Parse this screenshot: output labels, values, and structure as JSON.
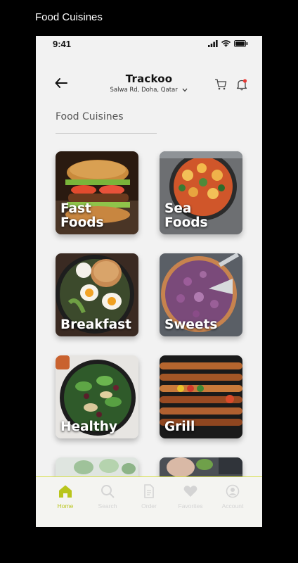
{
  "frame_title": "Food Cuisines",
  "status_bar": {
    "time": "9:41"
  },
  "header": {
    "title": "Trackoo",
    "location": "Salwa Rd, Doha, Qatar"
  },
  "section": {
    "title": "Food Cuisines"
  },
  "cuisines": [
    {
      "label": "Fast\nFoods"
    },
    {
      "label": "Sea\nFoods"
    },
    {
      "label": "Breakfast"
    },
    {
      "label": "Sweets"
    },
    {
      "label": "Healthy"
    },
    {
      "label": "Grill"
    }
  ],
  "bottom_nav": {
    "items": [
      {
        "label": "Home",
        "icon": "home-icon"
      },
      {
        "label": "Search",
        "icon": "search-icon"
      },
      {
        "label": "Order",
        "icon": "document-icon"
      },
      {
        "label": "Favorites",
        "icon": "heart-icon"
      },
      {
        "label": "Account",
        "icon": "user-icon"
      }
    ],
    "active_color": "#b9c51b",
    "inactive_color": "#d4d4d4"
  },
  "colors": {
    "accent": "#d6e04a",
    "background": "#f2f2f2",
    "notification": "#e53935"
  }
}
